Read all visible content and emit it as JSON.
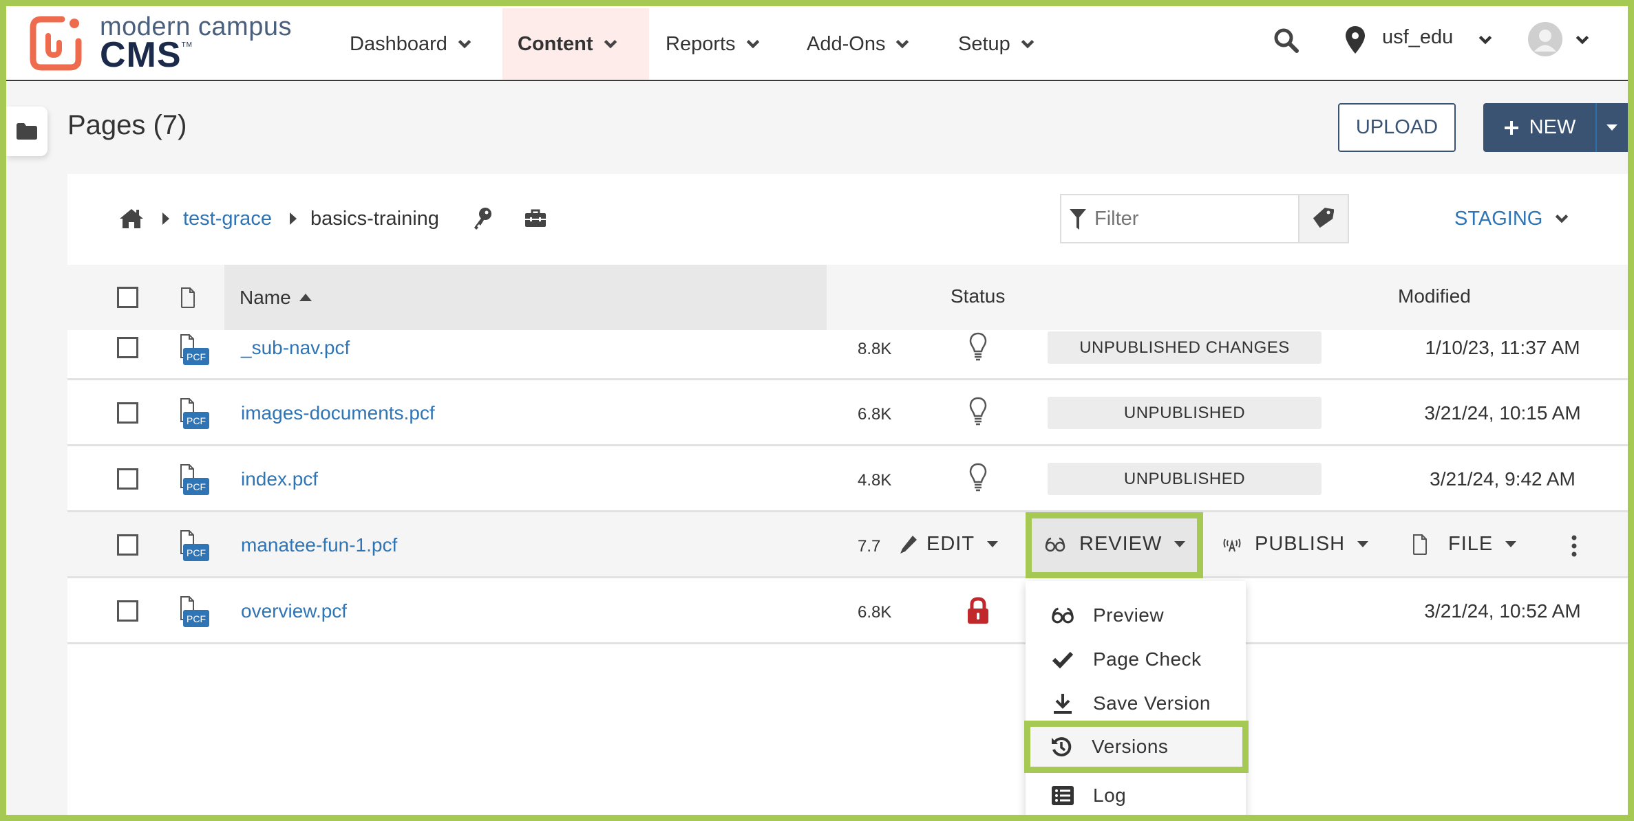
{
  "brand": {
    "line1": "modern campus",
    "line2": "CMS",
    "tm": "TM",
    "accent": "#ee6c4d",
    "navy": "#1b2a4a"
  },
  "nav": {
    "items": [
      {
        "label": "Dashboard",
        "active": false
      },
      {
        "label": "Content",
        "active": true
      },
      {
        "label": "Reports",
        "active": false
      },
      {
        "label": "Add-Ons",
        "active": false
      },
      {
        "label": "Setup",
        "active": false
      }
    ],
    "site": "usf_edu"
  },
  "page": {
    "title": "Pages (7)",
    "upload_label": "UPLOAD",
    "new_label": "NEW"
  },
  "breadcrumb": {
    "items": [
      "test-grace",
      "basics-training"
    ]
  },
  "filter": {
    "placeholder": "Filter",
    "value": ""
  },
  "environment": {
    "label": "STAGING"
  },
  "table": {
    "headers": {
      "name": "Name",
      "status": "Status",
      "modified": "Modified"
    },
    "rows": [
      {
        "name": "_sub-nav.pcf",
        "type": "PCF",
        "size": "8.8K",
        "status": "UNPUBLISHED CHANGES",
        "status_icon": "lightbulb",
        "modified": "1/10/23, 11:37 AM"
      },
      {
        "name": "images-documents.pcf",
        "type": "PCF",
        "size": "6.8K",
        "status": "UNPUBLISHED",
        "status_icon": "lightbulb",
        "modified": "3/21/24, 10:15 AM"
      },
      {
        "name": "index.pcf",
        "type": "PCF",
        "size": "4.8K",
        "status": "UNPUBLISHED",
        "status_icon": "lightbulb",
        "modified": "3/21/24, 9:42 AM"
      },
      {
        "name": "manatee-fun-1.pcf",
        "type": "PCF",
        "size": "7.7",
        "status": "",
        "status_icon": "",
        "modified": ""
      },
      {
        "name": "overview.pcf",
        "type": "PCF",
        "size": "6.8K",
        "status": "",
        "status_icon": "lock",
        "modified": "3/21/24, 10:52 AM"
      }
    ]
  },
  "row_actions": {
    "edit": "EDIT",
    "review": "REVIEW",
    "publish": "PUBLISH",
    "file": "FILE"
  },
  "review_menu": {
    "items": [
      {
        "label": "Preview",
        "icon": "glasses-icon"
      },
      {
        "label": "Page Check",
        "icon": "check-icon"
      },
      {
        "label": "Save Version",
        "icon": "download-icon"
      },
      {
        "label": "Versions",
        "icon": "history-icon",
        "highlighted": true
      },
      {
        "label": "Log",
        "icon": "list-icon"
      }
    ]
  },
  "colors": {
    "highlight": "#a6c953",
    "link": "#2f74b5",
    "primary_button": "#3a5373",
    "lock": "#c0282c"
  }
}
